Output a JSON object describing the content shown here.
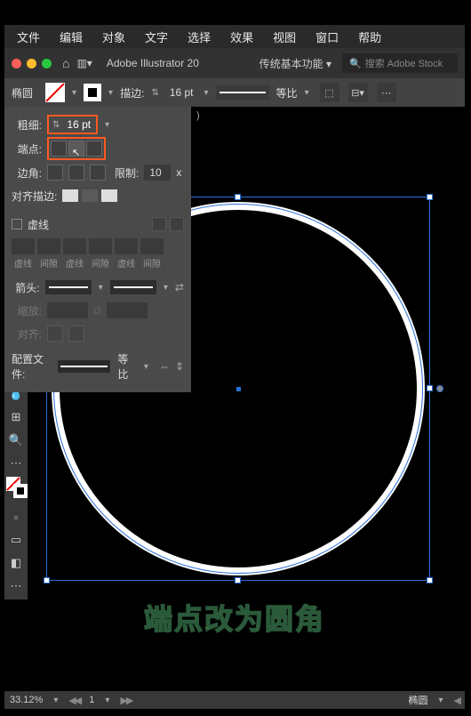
{
  "menubar": [
    "文件",
    "编辑",
    "对象",
    "文字",
    "选择",
    "效果",
    "视图",
    "窗口",
    "帮助"
  ],
  "app": {
    "title": "Adobe Illustrator 20",
    "preset": "传统基本功能",
    "search_placeholder": "搜索 Adobe Stock"
  },
  "optbar": {
    "shape": "椭圆",
    "stroke_label": "描边:",
    "stroke_pt": "16 pt",
    "profile": "等比"
  },
  "panel": {
    "weight_label": "粗细:",
    "weight_value": "16 pt",
    "cap_label": "端点:",
    "corner_label": "边角:",
    "limit_label": "限制:",
    "limit_value": "10",
    "limit_x": "x",
    "align_label": "对齐描边:",
    "dash_label": "虚线",
    "dash_cols": [
      "虚线",
      "间隙",
      "虚线",
      "间隙",
      "虚线",
      "间隙"
    ],
    "arrow_label": "箭头:",
    "scale_label": "缩放:",
    "arrowalign_label": "对齐:",
    "profile_label": "配置文件:",
    "profile_value": "等比"
  },
  "doc": {
    "tab_suffix": ")"
  },
  "caption": "端点改为圆角",
  "status": {
    "zoom": "33.12%",
    "nav": "1",
    "selection": "椭圆"
  }
}
